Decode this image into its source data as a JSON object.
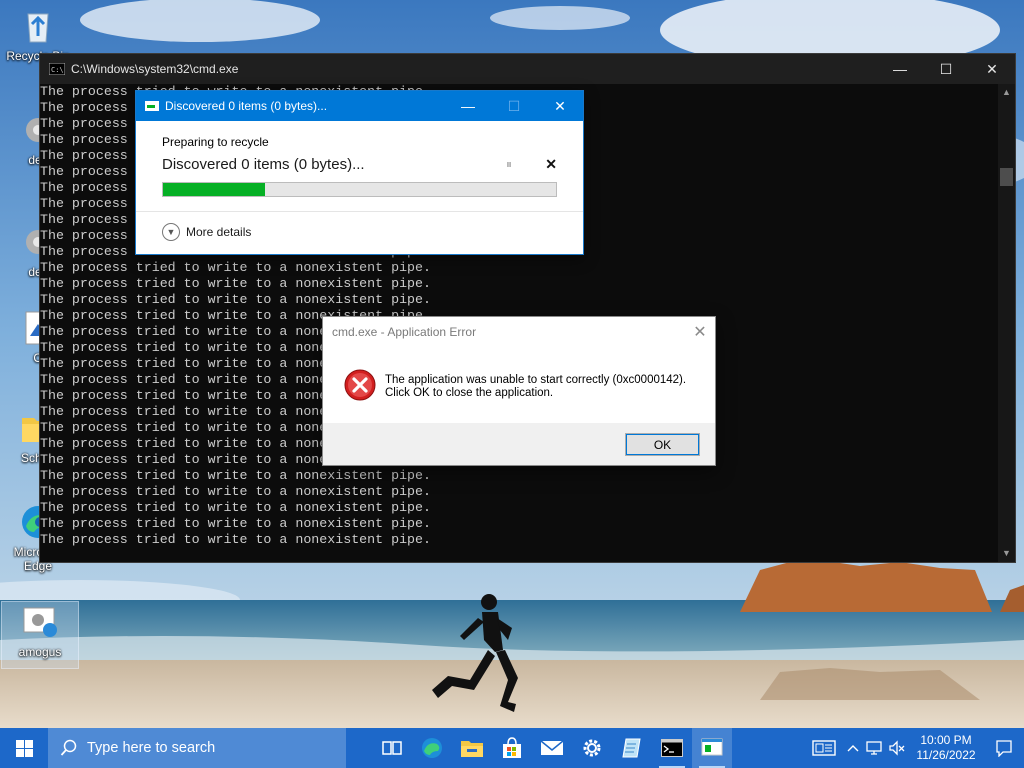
{
  "desktop": {
    "icons": [
      {
        "label": "Recycle Bin",
        "icon": "recycle-bin-icon"
      },
      {
        "label": "des",
        "icon": "settings-shortcut-icon"
      },
      {
        "label": "des",
        "icon": "settings-shortcut-icon"
      },
      {
        "label": "O",
        "icon": "app-shortcut-icon"
      },
      {
        "label": "Schoo",
        "icon": "folder-icon"
      },
      {
        "label": "Microsoft Edge",
        "icon": "edge-icon"
      },
      {
        "label": "amogus",
        "icon": "settings-shortcut-icon"
      }
    ]
  },
  "cmd": {
    "title": "C:\\Windows\\system32\\cmd.exe",
    "line": "The process tried to write to a nonexistent pipe.",
    "line_count": 29,
    "minimize": "—",
    "maximize": "☐",
    "close": "✕"
  },
  "recycle_dialog": {
    "title": "Discovered 0 items (0 bytes)...",
    "status": "Preparing to recycle",
    "discovered": "Discovered 0 items (0 bytes)...",
    "pause": "⏸",
    "stop": "✕",
    "progress": 0.26,
    "more_details": "More details",
    "minimize": "—",
    "maximize": "☐",
    "close": "✕"
  },
  "error_dialog": {
    "title": "cmd.exe - Application Error",
    "message_line1": "The application was unable to start correctly (0xc0000142).",
    "message_line2": "Click OK to close the application.",
    "ok": "OK",
    "close": "✕"
  },
  "taskbar": {
    "search_placeholder": "Type here to search",
    "apps": [
      "task-view-icon",
      "edge-icon",
      "file-explorer-icon",
      "store-icon",
      "mail-icon",
      "settings-icon",
      "notepad-icon",
      "cmd-icon",
      "control-panel-icon"
    ],
    "time": "10:00 PM",
    "date": "11/26/2022"
  },
  "colors": {
    "taskbar": "#1d68c9",
    "accent": "#0078d7",
    "progress": "#06b025",
    "error_red": "#d21f1f"
  }
}
